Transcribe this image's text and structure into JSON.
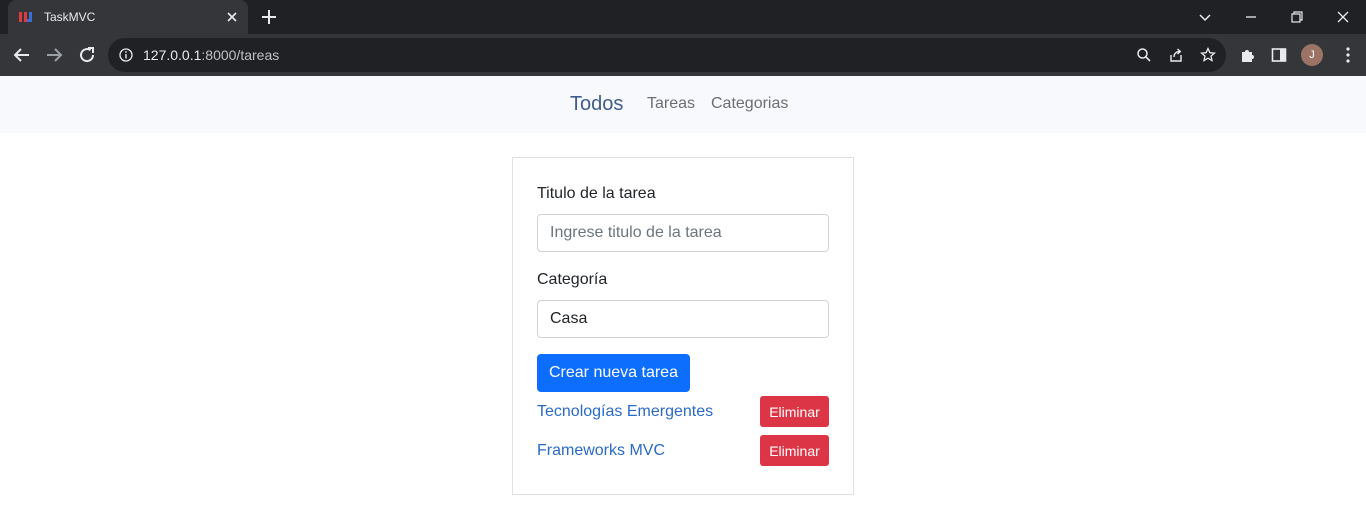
{
  "browser": {
    "tab_title": "TaskMVC",
    "url_host": "127.0.0.1",
    "url_path": ":8000/tareas",
    "profile_initial": "J",
    "icons": [
      "back-icon",
      "forward-icon",
      "reload-icon",
      "info-icon",
      "zoom-icon",
      "share-icon",
      "bookmark-star-icon",
      "extensions-icon",
      "side-panel-icon",
      "menu-icon",
      "minimize-icon",
      "restore-icon",
      "close-icon",
      "tab-search-icon",
      "new-tab-icon"
    ]
  },
  "navbar": {
    "brand": "Todos",
    "links": [
      "Tareas",
      "Categorias"
    ]
  },
  "form": {
    "title_label": "Titulo de la tarea",
    "title_placeholder": "Ingrese titulo de la tarea",
    "category_label": "Categoría",
    "category_selected": "Casa",
    "submit_label": "Crear nueva tarea"
  },
  "tasks": [
    {
      "title": "Tecnologías Emergentes",
      "delete_label": "Eliminar"
    },
    {
      "title": "Frameworks MVC",
      "delete_label": "Eliminar"
    }
  ],
  "colors": {
    "primary": "#0d6efd",
    "danger": "#dc3545",
    "link": "#2a6ac8",
    "brand": "#3f5c8c"
  }
}
